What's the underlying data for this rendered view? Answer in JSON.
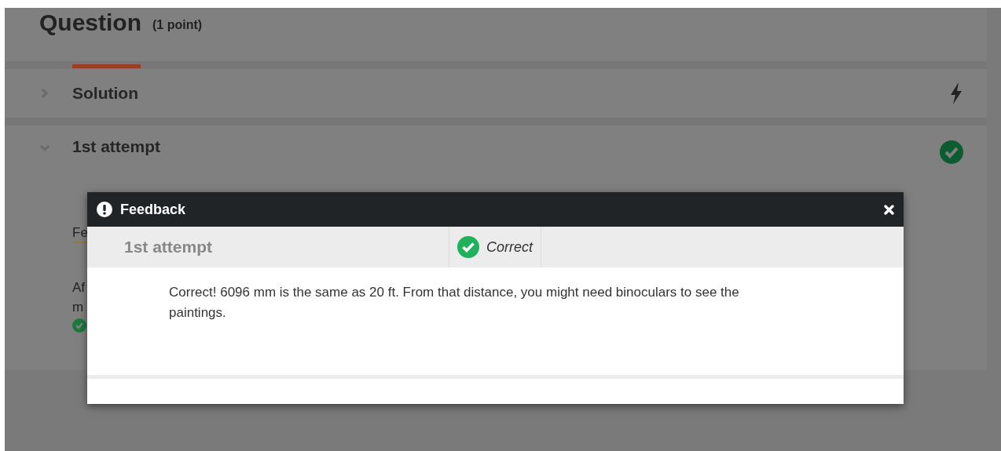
{
  "page": {
    "question": {
      "title": "Question",
      "points": "(1 point)"
    },
    "sections": [
      {
        "title": "Solution",
        "kind": "bolt",
        "expanded": false,
        "selected": true
      },
      {
        "title": "1st attempt",
        "kind": "check",
        "expanded": true,
        "selected": false,
        "feedback_link": "Fe",
        "lines": [
          "Af",
          "m"
        ]
      }
    ]
  },
  "dialog": {
    "title": "Feedback",
    "attempt": "1st attempt",
    "result": "Correct",
    "message": "Correct! 6096 mm is the same as 20 ft. From that distance, you might need binoculars to see the paintings."
  }
}
